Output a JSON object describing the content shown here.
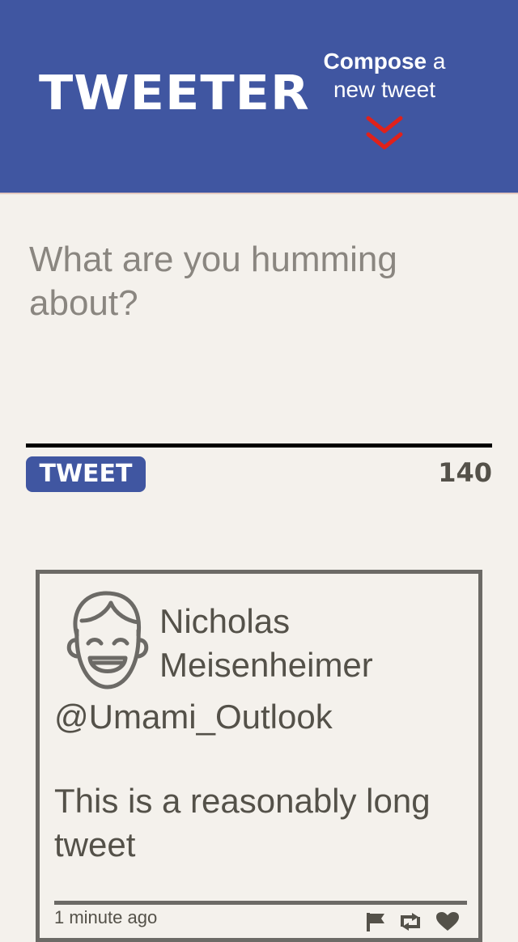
{
  "header": {
    "logo": "TWEETER",
    "compose_strong": "Compose",
    "compose_rest": " a",
    "compose_line2": "new tweet"
  },
  "compose": {
    "placeholder": "What are you humming about?",
    "button_label": "TWEET",
    "counter": "140"
  },
  "tweet": {
    "name": "Nicholas Meisenheimer",
    "handle": "@Umami_Outlook",
    "text": "This is a reasonably long tweet",
    "timestamp": "1 minute ago"
  },
  "colors": {
    "header_bg": "#4056a1",
    "page_bg": "#f4f1ec",
    "text": "#545149",
    "chevron": "#e0211b"
  },
  "icons": [
    "chevron-down-double-icon",
    "avatar-icon",
    "flag-icon",
    "retweet-icon",
    "heart-icon"
  ]
}
